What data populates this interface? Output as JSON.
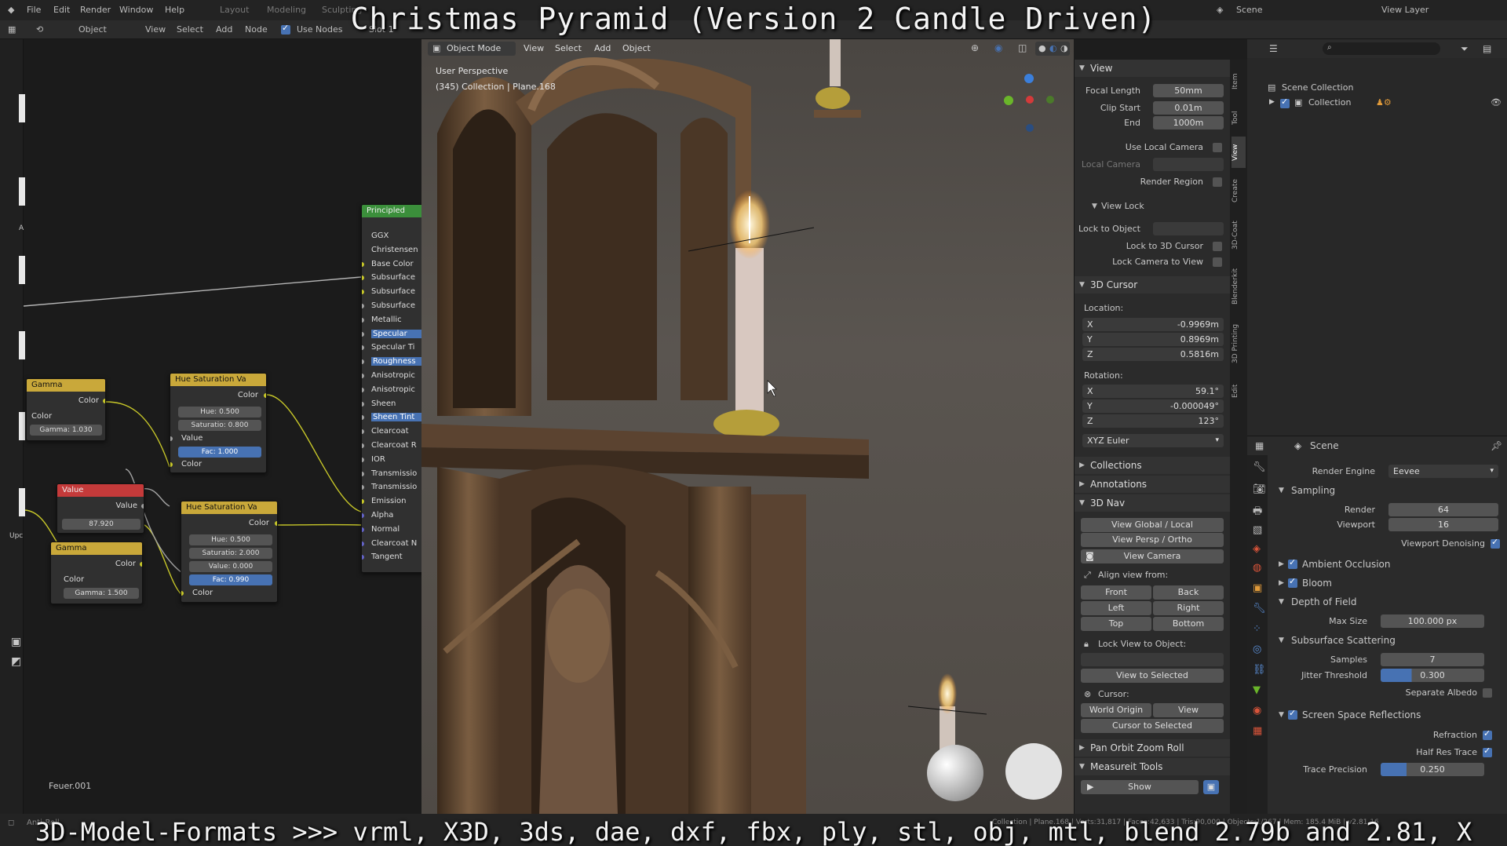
{
  "overlay": {
    "title": "Christmas Pyramid (Version 2 Candle Driven)",
    "bottom": "3D-Model-Formats >>> vrml, X3D, 3ds, dae, dxf, fbx, ply, stl, obj, mtl, blend 2.79b and 2.81, X"
  },
  "topbar": {
    "menus": [
      "File",
      "Edit",
      "Render",
      "Window",
      "Help",
      "Layout",
      "Modeling",
      "Sculpting"
    ],
    "scene": "Scene",
    "view_layer": "View Layer"
  },
  "node_header": {
    "object": "Object",
    "view": "View",
    "select": "Select",
    "add": "Add",
    "node": "Node",
    "use_nodes": "Use Nodes",
    "slot": "Slot 1"
  },
  "nodes": {
    "principled": {
      "title": "Principled",
      "rows": [
        "GGX",
        "Christensen",
        "Base Color",
        "Subsurface",
        "Subsurface",
        "Subsurface",
        "Metallic",
        "Specular",
        "Specular Ti",
        "Roughness",
        "Anisotropic",
        "Anisotropic",
        "Sheen",
        "Sheen Tint",
        "Clearcoat",
        "Clearcoat R",
        "IOR",
        "Transmissio",
        "Transmissio",
        "Emission",
        "Alpha",
        "Normal",
        "Clearcoat N",
        "Tangent"
      ]
    },
    "gamma1": {
      "title": "Gamma",
      "out": "Color",
      "in": "Color",
      "field": "Gamma",
      "value": "1.030"
    },
    "value": {
      "title": "Value",
      "out": "Value",
      "value": "87.920"
    },
    "gamma2": {
      "title": "Gamma",
      "out": "Color",
      "in": "Color",
      "field": "Gamma",
      "value": "1.500"
    },
    "huesat1": {
      "title": "Hue Saturation Va",
      "out": "Color",
      "hue_l": "Hue",
      "hue": "0.500",
      "sat_l": "Saturatio",
      "sat": "0.800",
      "val": "Value",
      "fac_l": "Fac",
      "fac": "1.000",
      "in": "Color"
    },
    "huesat2": {
      "title": "Hue Saturation Va",
      "out": "Color",
      "hue_l": "Hue",
      "hue": "0.500",
      "sat_l": "Saturatio",
      "sat": "2.000",
      "val_l": "Value",
      "val": "0.000",
      "fac_l": "Fac",
      "fac": "0.990",
      "in": "Color"
    },
    "material_name": "Feuer.001",
    "side_letters": [
      "A",
      "Upc"
    ]
  },
  "viewport": {
    "mode": "Object Mode",
    "menus": [
      "View",
      "Select",
      "Add",
      "Object"
    ],
    "perspective": "User Perspective",
    "collection": "(345) Collection | Plane.168"
  },
  "npanel": {
    "tabs": [
      "Item",
      "Tool",
      "View",
      "Create",
      "3D-Coat",
      "Blenderkit",
      "3D Printing",
      "Edit"
    ],
    "view": {
      "header": "View",
      "focal_l": "Focal Length",
      "focal": "50mm",
      "clipstart_l": "Clip Start",
      "clipstart": "0.01m",
      "end_l": "End",
      "end": "1000m",
      "uselocal": "Use Local Camera",
      "localcam": "Local Camera",
      "renderregion": "Render Region",
      "viewlock": "View Lock",
      "locktoobj": "Lock to Object",
      "lockcursor": "Lock to 3D Cursor",
      "lockcam": "Lock Camera to View"
    },
    "cursor": {
      "header": "3D Cursor",
      "location": "Location:",
      "x_l": "X",
      "x": "-0.9969m",
      "y_l": "Y",
      "y": "0.8969m",
      "z_l": "Z",
      "z": "0.5816m",
      "rotation": "Rotation:",
      "rx": "59.1°",
      "ry": "-0.000049°",
      "rz": "123°",
      "mode": "XYZ Euler"
    },
    "collections": "Collections",
    "annotations": "Annotations",
    "nav": {
      "header": "3D Nav",
      "global": "View Global / Local",
      "persp": "View Persp / Ortho",
      "camera": "View Camera",
      "align": "Align view from:",
      "front": "Front",
      "back": "Back",
      "left": "Left",
      "right": "Right",
      "top": "Top",
      "bottom": "Bottom",
      "lockview": "Lock View to Object:",
      "toselected": "View to Selected",
      "cursor": "Cursor:",
      "worldorigin": "World Origin",
      "view": "View",
      "cursorsel": "Cursor to Selected"
    },
    "panorbit": "Pan Orbit Zoom Roll",
    "measure": "Measureit Tools",
    "show": "Show"
  },
  "outliner": {
    "scene_collection": "Scene Collection",
    "collection": "Collection"
  },
  "props": {
    "scene": "Scene",
    "engine_l": "Render Engine",
    "engine": "Eevee",
    "sampling": "Sampling",
    "render_l": "Render",
    "render": "64",
    "viewport_l": "Viewport",
    "viewport": "16",
    "denoise": "Viewport Denoising",
    "ao": "Ambient Occlusion",
    "bloom": "Bloom",
    "dof": "Depth of Field",
    "maxsize_l": "Max Size",
    "maxsize": "100.000 px",
    "sss": "Subsurface Scattering",
    "samples_l": "Samples",
    "samples": "7",
    "jitter_l": "Jitter Threshold",
    "jitter": "0.300",
    "sepalbedo": "Separate Albedo",
    "ssr": "Screen Space Reflections",
    "refraction": "Refraction",
    "halfres": "Half Res Trace",
    "precision_l": "Trace Precision",
    "precision": "0.250"
  },
  "status": {
    "left": "Anti-Roll",
    "right": "Collection | Plane.168 | Verts:31,817 | Faces:42,633 | Tris:90,000 | Objects:1/267 | Mem: 185.4 MiB | v2.81.16"
  },
  "colors": {
    "accent": "#4772b3",
    "node_yellow": "#c9a83a",
    "node_red": "#c43a3a",
    "node_green": "#3b8f3b"
  }
}
